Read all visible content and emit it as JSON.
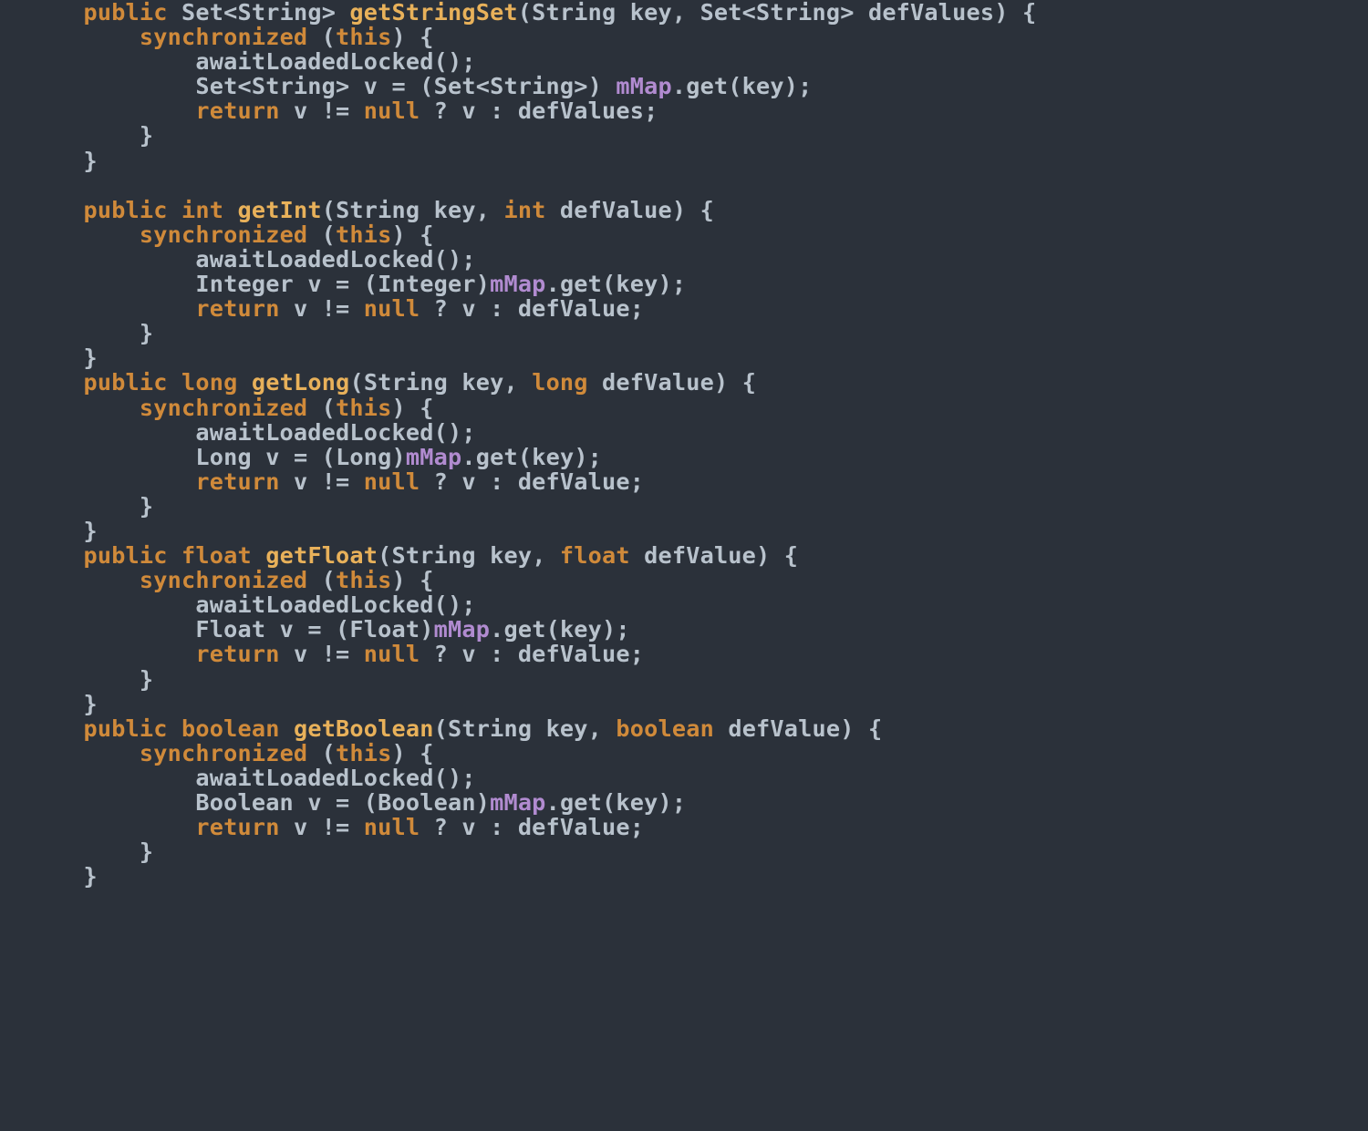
{
  "colors": {
    "background": "#2b313a",
    "default_text": "#b8c2cc",
    "keyword": "#d08a3a",
    "method_name": "#e8b15a",
    "field": "#b18bd0",
    "line_number": "#3a4350"
  },
  "language": "Java",
  "tokens": {
    "public": "public",
    "int": "int",
    "long": "long",
    "float": "float",
    "boolean": "boolean",
    "synchronized": "synchronized",
    "this": "this",
    "return": "return",
    "null": "null",
    "Set": "Set",
    "String": "String",
    "Integer": "Integer",
    "Long": "Long",
    "Float": "Float",
    "Boolean": "Boolean",
    "key": "key",
    "defValue": "defValue",
    "defValues": "defValues",
    "v": "v",
    "mMap": "mMap",
    "get": "get",
    "awaitLoadedLocked": "awaitLoadedLocked",
    "getStringSet": "getStringSet",
    "getInt": "getInt",
    "getLong": "getLong",
    "getFloat": "getFloat",
    "getBoolean": "getBoolean"
  },
  "indent": {
    "i1": "    ",
    "i2": "        ",
    "i3": "            "
  },
  "source_lines": [
    "    public Set<String> getStringSet(String key, Set<String> defValues) {",
    "        synchronized (this) {",
    "            awaitLoadedLocked();",
    "            Set<String> v = (Set<String>) mMap.get(key);",
    "            return v != null ? v : defValues;",
    "        }",
    "    }",
    "",
    "    public int getInt(String key, int defValue) {",
    "        synchronized (this) {",
    "            awaitLoadedLocked();",
    "            Integer v = (Integer)mMap.get(key);",
    "            return v != null ? v : defValue;",
    "        }",
    "    }",
    "    public long getLong(String key, long defValue) {",
    "        synchronized (this) {",
    "            awaitLoadedLocked();",
    "            Long v = (Long)mMap.get(key);",
    "            return v != null ? v : defValue;",
    "        }",
    "    }",
    "    public float getFloat(String key, float defValue) {",
    "        synchronized (this) {",
    "            awaitLoadedLocked();",
    "            Float v = (Float)mMap.get(key);",
    "            return v != null ? v : defValue;",
    "        }",
    "    }",
    "    public boolean getBoolean(String key, boolean defValue) {",
    "        synchronized (this) {",
    "            awaitLoadedLocked();",
    "            Boolean v = (Boolean)mMap.get(key);",
    "            return v != null ? v : defValue;",
    "        }",
    "    }"
  ]
}
